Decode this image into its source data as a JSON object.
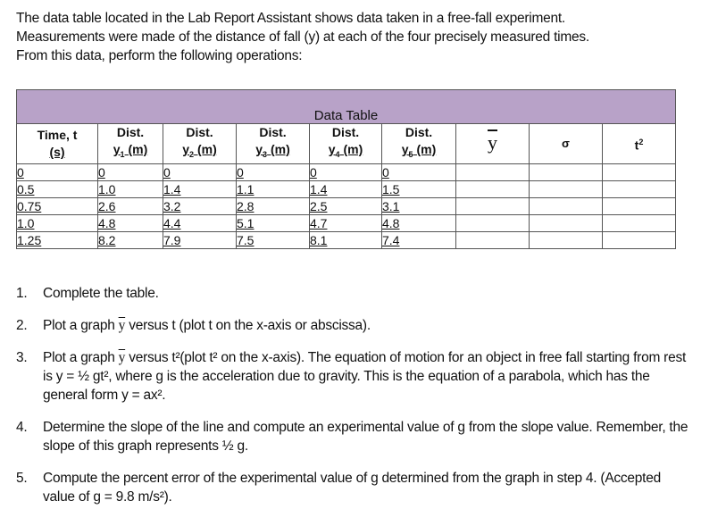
{
  "intro": {
    "line1": "The data table located in the Lab Report Assistant shows data taken in a free-fall experiment.",
    "line2": "Measurements were made of the distance of fall (y) at each of the four precisely measured times.",
    "line3": "From this data, perform the following operations:"
  },
  "table": {
    "title": "Data Table",
    "header_color": "#b8a2c8",
    "columns": [
      {
        "line1": "Time, t",
        "line2": "(s)"
      },
      {
        "line1": "Dist.",
        "var": "y",
        "sub": "1",
        "unit": "(m)"
      },
      {
        "line1": "Dist.",
        "var": "y",
        "sub": "2",
        "unit": "(m)"
      },
      {
        "line1": "Dist.",
        "var": "y",
        "sub": "3",
        "unit": "(m)"
      },
      {
        "line1": "Dist.",
        "var": "y",
        "sub": "4",
        "unit": "(m)"
      },
      {
        "line1": "Dist.",
        "var": "y",
        "sub": "5",
        "unit": "(m)"
      },
      {
        "symbol": "y"
      },
      {
        "symbol": "σ"
      },
      {
        "symbol": "t",
        "sup": "2"
      }
    ],
    "rows": [
      [
        "0",
        "0",
        "0",
        "0",
        "0",
        "0",
        "",
        "",
        ""
      ],
      [
        "0.5",
        "1.0",
        "1.4",
        "1.1",
        "1.4",
        "1.5",
        "",
        "",
        ""
      ],
      [
        "0.75",
        "2.6",
        "3.2",
        "2.8",
        "2.5",
        "3.1",
        "",
        "",
        ""
      ],
      [
        "1.0",
        "4.8",
        "4.4",
        "5.1",
        "4.7",
        "4.8",
        "",
        "",
        ""
      ],
      [
        "1.25",
        "8.2",
        "7.9",
        "7.5",
        "8.1",
        "7.4",
        "",
        "",
        ""
      ]
    ]
  },
  "steps": [
    {
      "num": "1.",
      "text": "Complete the table."
    },
    {
      "num": "2.",
      "pre": "Plot a graph ",
      "ybar": "y",
      "post": " versus t (plot t on the x-axis or abscissa)."
    },
    {
      "num": "3.",
      "pre": "Plot a graph ",
      "ybar": "y",
      "post": " versus t²(plot t² on the x-axis). The equation of motion for an object in free fall starting from rest is y = ½ gt², where g is the acceleration due to gravity. This is the equation of a parabola, which has the general form y = ax²."
    },
    {
      "num": "4.",
      "text": "Determine the slope of the line and compute an experimental value of g from the slope value. Remember, the slope of this graph represents ½ g."
    },
    {
      "num": "5.",
      "text": "Compute the percent error of the experimental value of g determined from the graph in step 4. (Accepted value of g = 9.8 m/s²)."
    }
  ]
}
